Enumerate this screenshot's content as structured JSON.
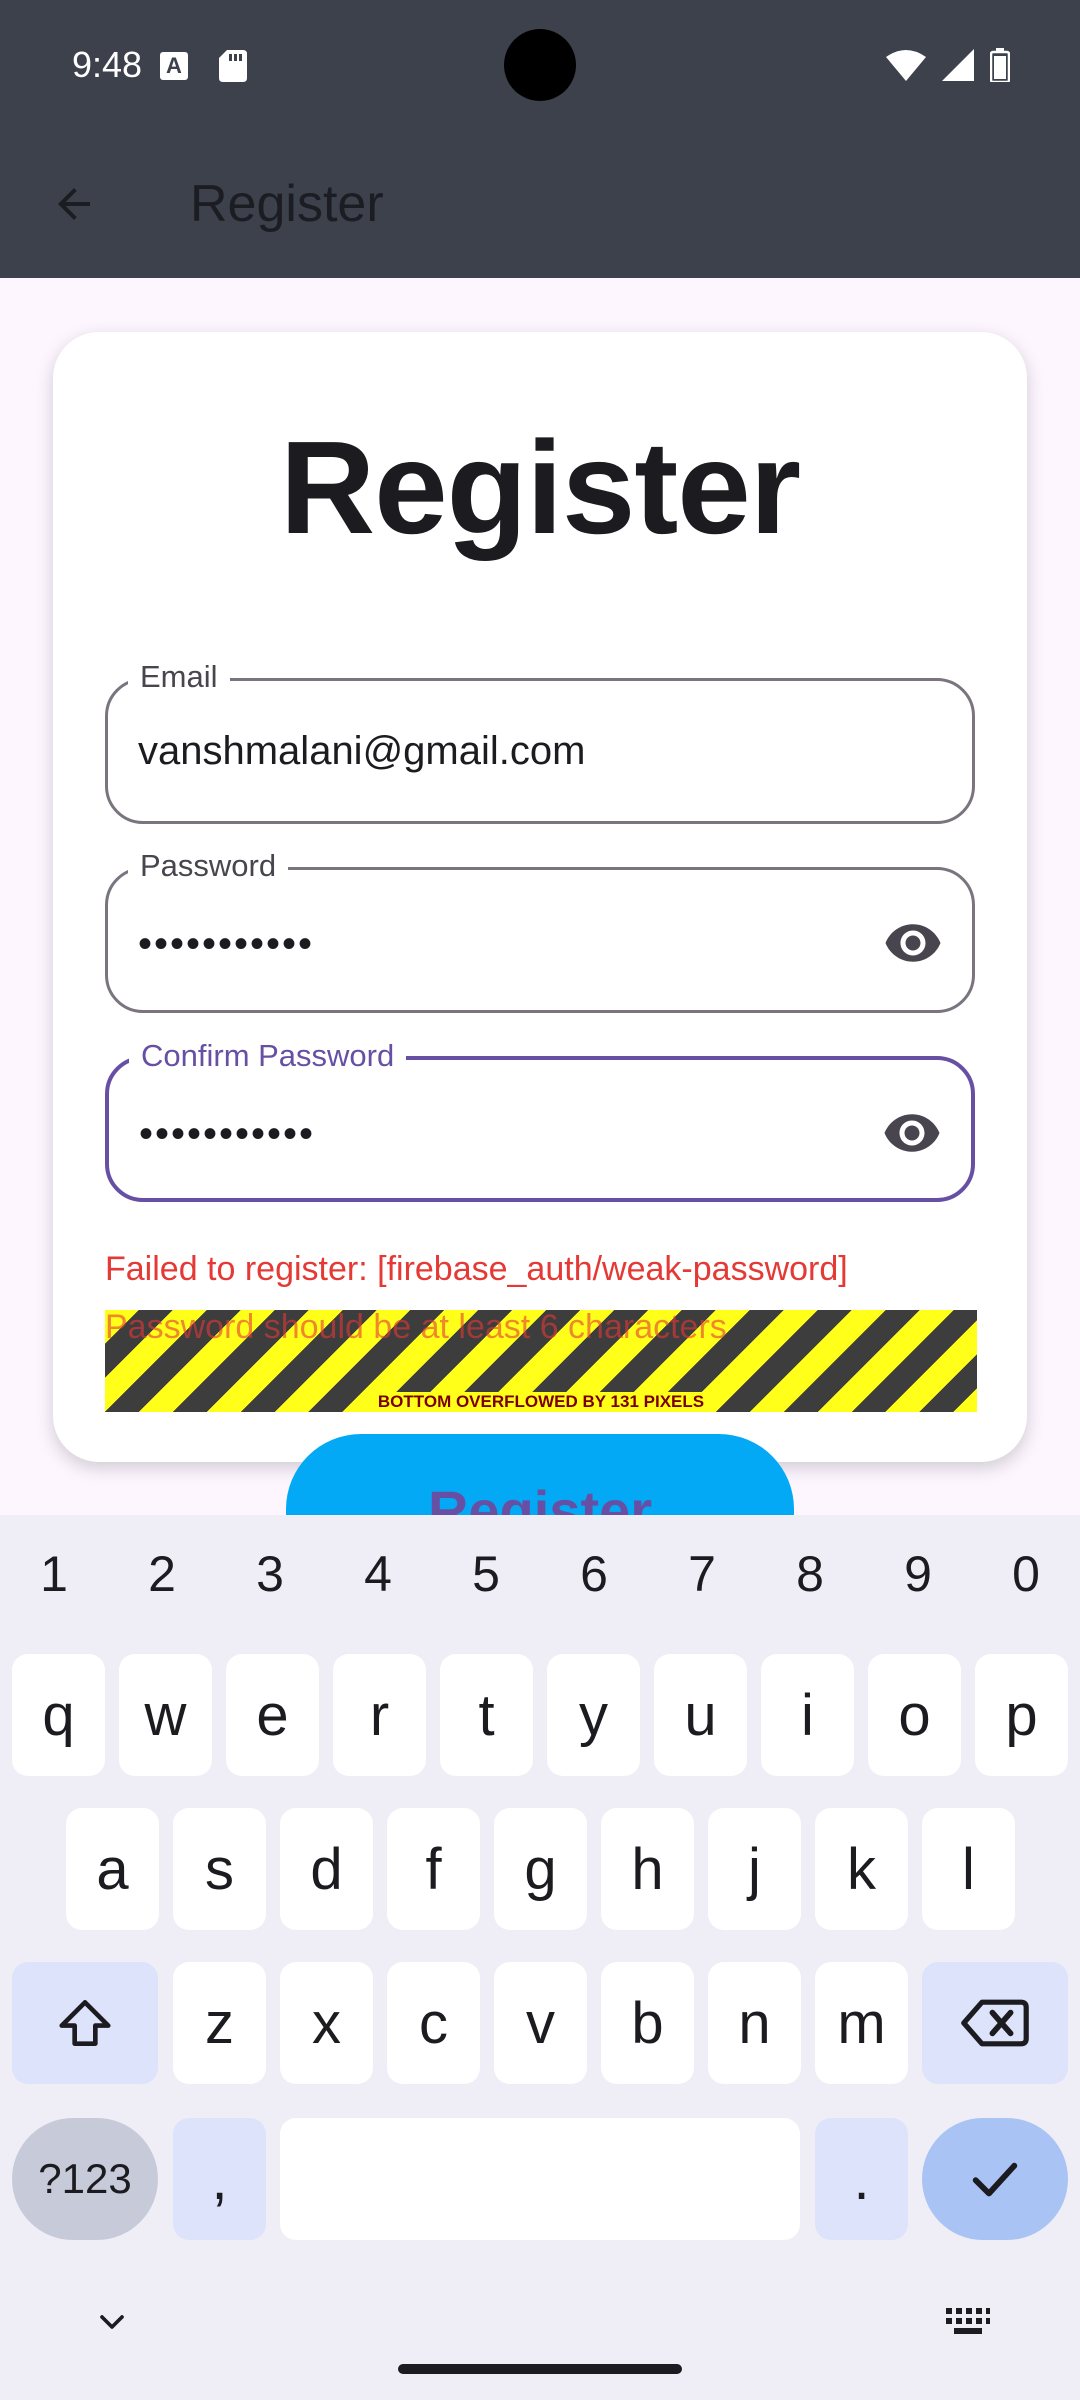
{
  "status_bar": {
    "time": "9:48"
  },
  "app_bar": {
    "title": "Register"
  },
  "card": {
    "title": "Register"
  },
  "form": {
    "email": {
      "label": "Email",
      "value": "vanshmalani@gmail.com"
    },
    "password": {
      "label": "Password",
      "value": "•••••••••••"
    },
    "confirm_password": {
      "label": "Confirm Password",
      "value": "•••••••••••"
    }
  },
  "error": {
    "message": "Failed to register: [firebase_auth/weak-password]",
    "clipped_message": "Password should be at least 6 characters",
    "overflow_warning": "BOTTOM OVERFLOWED BY 131 PIXELS"
  },
  "register_button": {
    "label": "Register"
  },
  "keyboard": {
    "numbers": [
      "1",
      "2",
      "3",
      "4",
      "5",
      "6",
      "7",
      "8",
      "9",
      "0"
    ],
    "row1": [
      "q",
      "w",
      "e",
      "r",
      "t",
      "y",
      "u",
      "i",
      "o",
      "p"
    ],
    "row2": [
      "a",
      "s",
      "d",
      "f",
      "g",
      "h",
      "j",
      "k",
      "l"
    ],
    "row3": [
      "z",
      "x",
      "c",
      "v",
      "b",
      "n",
      "m"
    ],
    "symbols_key": "?123",
    "comma_key": ",",
    "period_key": "."
  },
  "colors": {
    "app_bar": "#3c414b",
    "focus": "#6750a4",
    "error": "#e53935",
    "button": "#03a9f4"
  }
}
